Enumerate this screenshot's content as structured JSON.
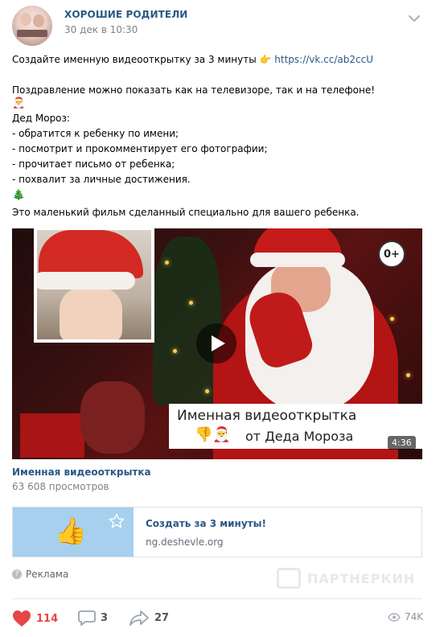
{
  "header": {
    "group_name": "ХОРОШИЕ РОДИТЕЛИ",
    "date": "30 дек в 10:30",
    "avatar_icon": "group-avatar",
    "menu_icon": "chevron-down-icon"
  },
  "post": {
    "line1_text": "Создайте именную видеооткрытку за 3 минуты",
    "line1_emoji": "👉",
    "line1_link": "https://vk.cc/ab2ccU",
    "line2": "Поздравление можно показать как на телевизоре, так и на телефоне!",
    "emoji_santa": "🎅",
    "line3": "Дед Мороз:",
    "line4": "- обратится к ребенку по имени;",
    "line5": "- посмотрит и прокомментирует его фотографии;",
    "line6": "- прочитает письмо от ребенка;",
    "line7": "- похвалит за личные достижения.",
    "emoji_tree": "🎄",
    "line8": "Это маленький фильм сделанный специально для вашего ребенка."
  },
  "video": {
    "age_rating": "0+",
    "caption_line1": "Именная видеооткрытка",
    "caption_line2": "от Деда Мороза",
    "caption_emoji": "👎🎅",
    "duration": "4:36",
    "title": "Именная видеооткрытка",
    "views": "63 608 просмотров"
  },
  "ad_card": {
    "image_icon": "thumbs-up-icon",
    "image_emoji": "👍",
    "star_icon": "star-icon",
    "title": "Создать за 3 минуты!",
    "domain": "ng.deshevle.org",
    "bg_color": "#a7d0ee"
  },
  "ad_label": {
    "text": "Реклама",
    "icon": "ad-info-icon"
  },
  "watermark": {
    "text": "ПАРТНЕРКИН"
  },
  "footer": {
    "likes": "114",
    "comments": "3",
    "shares": "27",
    "views": "74K",
    "like_color": "#e64646"
  }
}
